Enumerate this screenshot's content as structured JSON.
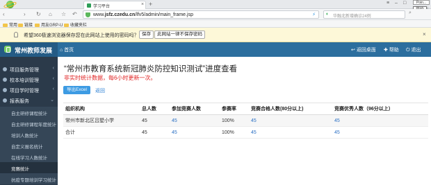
{
  "browser": {
    "tab_title": "学习平台",
    "url_prefix": "www.",
    "url_host": "jsfz.czedu.cn",
    "url_path": "/lfv5/admin/main_frame.jsp",
    "search_placeholder": "华融北新增确诊24例",
    "tooltip": "Poin...",
    "start_label": "开始",
    "bookmarks": [
      "常用",
      "链接",
      "用友GRP-U",
      "收藏夹栏"
    ]
  },
  "notice": {
    "message": "希望360极速浏览器保存您在此网站上使用的密码吗？",
    "save_label": "保存",
    "never_label": "此网站一律不保存密码"
  },
  "header": {
    "brand": "常州教师发展",
    "home": "首页",
    "back_home": "返回桌面",
    "help": "帮助",
    "logout": "退出"
  },
  "sidebar": {
    "items": [
      {
        "label": "项目服务管理"
      },
      {
        "label": "校本培训管理"
      },
      {
        "label": "项目学时管理"
      },
      {
        "label": "报表服务"
      }
    ],
    "sub_items": [
      {
        "label": "自主研修课程统计"
      },
      {
        "label": "自主研修课程年度统计"
      },
      {
        "label": "培训人数统计"
      },
      {
        "label": "自定义报名统计"
      },
      {
        "label": "在线学习人数统计"
      },
      {
        "label": "竞赛统计"
      },
      {
        "label": "抗疫专题培训学习统计"
      }
    ]
  },
  "main": {
    "title": "“常州市教育系统新冠肺炎防控知识测试”进度查看",
    "note": "非实时统计数据，每6小时更新一次。",
    "export_label": "导出Excel",
    "back_label": "返回",
    "table": {
      "headers": [
        "组织机构",
        "总人数",
        "参加竞赛人数",
        "参赛率",
        "竞赛合格人数(80分以上)",
        "竞赛优秀人数（96分以上）"
      ],
      "rows": [
        [
          "常州市新北区吕墅小学",
          "45",
          "45",
          "100%",
          "45",
          "45"
        ],
        [
          "合计",
          "45",
          "45",
          "100%",
          "45",
          "45"
        ]
      ]
    }
  }
}
